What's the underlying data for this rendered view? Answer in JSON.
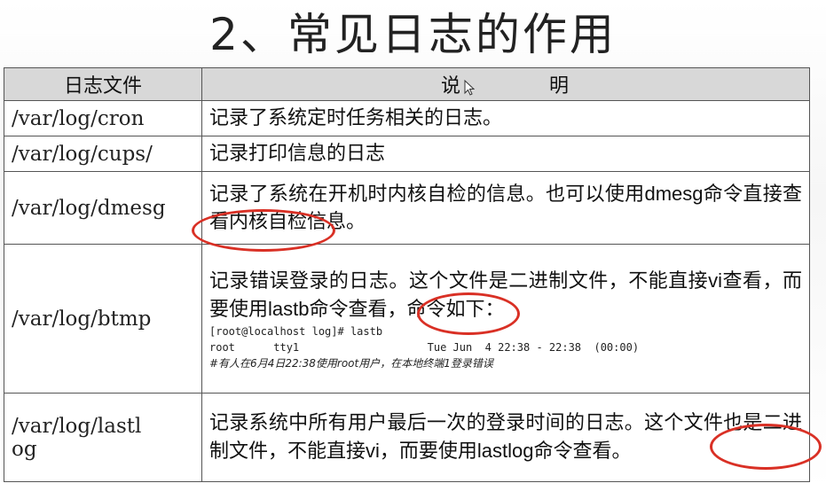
{
  "title": "2、常见日志的作用",
  "table": {
    "headers": {
      "file": "日志文件",
      "desc_left": "说",
      "desc_right": "明"
    },
    "rows": [
      {
        "path": "/var/log/cron",
        "desc": "记录了系统定时任务相关的日志。"
      },
      {
        "path": "/var/log/cups/",
        "desc": "记录打印信息的日志"
      },
      {
        "path": "/var/log/dmesg",
        "desc_a": "记录了系统在开机时内核自检的信息。也可以使用",
        "desc_cmd": "dmesg",
        "desc_b": "命令直接查看内核自检信息。"
      },
      {
        "path": "/var/log/btmp",
        "desc_a": "记录错误登录的日志。这个文件是二进制文件，不能直接",
        "desc_vi": "vi",
        "desc_b": "查看，而要使用",
        "desc_cmd": "lastb",
        "desc_c": "命令查看，命令如下：",
        "code_line1": "[root@localhost log]# lastb",
        "code_line2": "root      tty1                    Tue Jun  4 22:38 - 22:38  (00:00)",
        "note": "#有人在6月4日22:38使用root用户，在本地终端1登录错误"
      },
      {
        "path_a": "/var/log/lastl",
        "path_b": "og",
        "desc_a": "记录系统中所有用户最后一次的登录时间的日志。这个文件也是二进制文件，不能直接",
        "desc_vi": "vi",
        "desc_b": "，而要使用",
        "desc_cmd": "lastlog",
        "desc_c": "命令查看。"
      }
    ]
  },
  "annotation_color": "#d93025",
  "icons": [
    "cursor-arrow-icon"
  ]
}
